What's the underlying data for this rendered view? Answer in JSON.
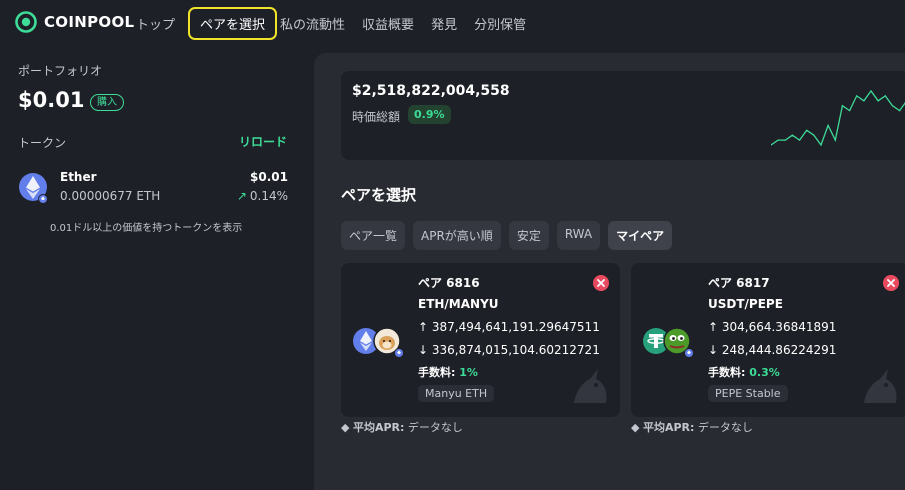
{
  "brand": {
    "name": "COINPOOL",
    "accent": "#3ddc97"
  },
  "nav": {
    "items": [
      "トップ",
      "ペアを選択",
      "私の流動性",
      "収益概要",
      "発見",
      "分別保管"
    ],
    "active": "ペアを選択",
    "highlight_color": "#f0e42a"
  },
  "portfolio": {
    "label": "ポートフォリオ",
    "total": "$0.01",
    "buy_label": "購入",
    "tokens_label": "トークン",
    "reload_label": "リロード",
    "tokens": [
      {
        "name": "Ether",
        "amount": "0.00000677 ETH",
        "value": "$0.01",
        "change": "0.14%",
        "icon": "eth-icon"
      }
    ],
    "note": "0.01ドル以上の価値を持つトークンを表示"
  },
  "stats": {
    "tvl": "$2,518,822,004,558",
    "tvl_label": "時価総額",
    "tvl_change": "0.9%"
  },
  "chart_data": {
    "type": "line",
    "values": [
      3,
      4,
      4,
      5,
      4,
      6,
      5,
      3,
      7,
      4,
      11,
      10,
      13,
      12,
      14,
      12,
      13,
      11,
      10,
      12,
      13,
      12
    ]
  },
  "pairs": {
    "title": "ペアを選択",
    "tabs": [
      "ペア一覧",
      "APRが高い順",
      "安定",
      "RWA",
      "マイペア"
    ],
    "active_tab": "マイペア",
    "cards": [
      {
        "id": "ペア 6816",
        "symbol": "ETH/MANYU",
        "reserve_a": "↑ 387,494,641,191.29647511",
        "reserve_b": "↓ 336,874,015,104.60212721",
        "fee_label": "手数料:",
        "fee": "1%",
        "tag": "Manyu ETH",
        "apr_label": "平均APR:",
        "apr_value": "データなし",
        "icons": [
          "eth-icon",
          "manyu-icon"
        ]
      },
      {
        "id": "ペア 6817",
        "symbol": "USDT/PEPE",
        "reserve_a": "↑ 304,664.36841891",
        "reserve_b": "↓ 248,444.86224291",
        "fee_label": "手数料:",
        "fee": "0.3%",
        "tag": "PEPE Stable",
        "apr_label": "平均APR:",
        "apr_value": "データなし",
        "icons": [
          "usdt-icon",
          "pepe-icon"
        ]
      }
    ]
  }
}
